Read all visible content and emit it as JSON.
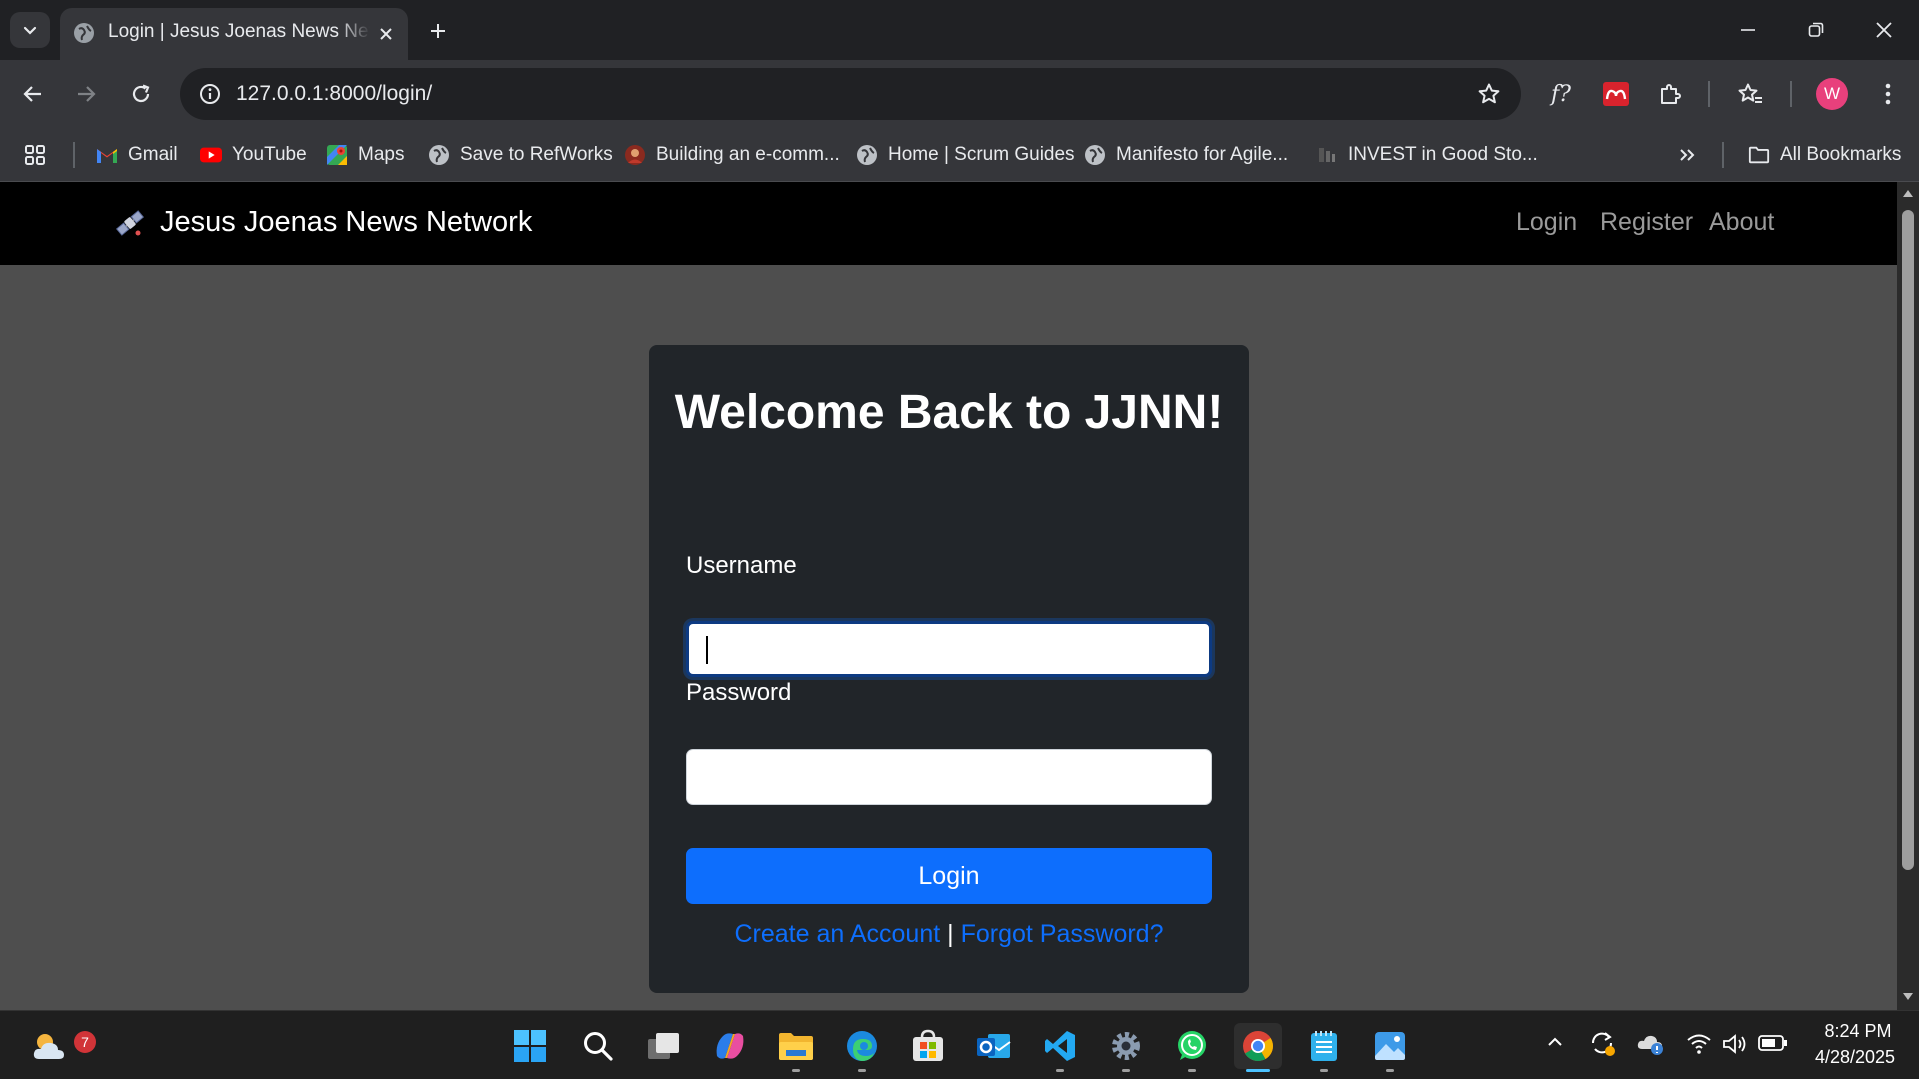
{
  "browser": {
    "tab_title": "Login | Jesus Joenas News Network",
    "url": "127.0.0.1:8000/login/",
    "avatar_letter": "W",
    "bookmarks": [
      {
        "label": "Gmail",
        "icon": "gmail-icon"
      },
      {
        "label": "YouTube",
        "icon": "youtube-icon"
      },
      {
        "label": "Maps",
        "icon": "maps-icon"
      },
      {
        "label": "Save to RefWorks",
        "icon": "globe-icon"
      },
      {
        "label": "Building an e-comm...",
        "icon": "site-icon"
      },
      {
        "label": "Home | Scrum Guides",
        "icon": "globe-icon"
      },
      {
        "label": "Manifesto for Agile...",
        "icon": "globe-icon"
      },
      {
        "label": "INVEST in Good Sto...",
        "icon": "site-icon"
      }
    ],
    "all_bookmarks_label": "All Bookmarks"
  },
  "site": {
    "brand": "Jesus Joenas News Network",
    "nav": {
      "login": "Login",
      "register": "Register",
      "about": "About"
    }
  },
  "login_form": {
    "title": "Welcome Back to JJNN!",
    "username_label": "Username",
    "username_value": "",
    "password_label": "Password",
    "password_value": "",
    "submit_label": "Login",
    "create_account": "Create an Account",
    "separator": "|",
    "forgot_password": "Forgot Password?"
  },
  "taskbar": {
    "weather_badge": "7",
    "time": "8:24 PM",
    "date": "4/28/2025"
  },
  "colors": {
    "primary": "#0d6efd",
    "card_bg": "#212529",
    "page_bg": "#4e4e4e",
    "navbar_bg": "#000000"
  }
}
